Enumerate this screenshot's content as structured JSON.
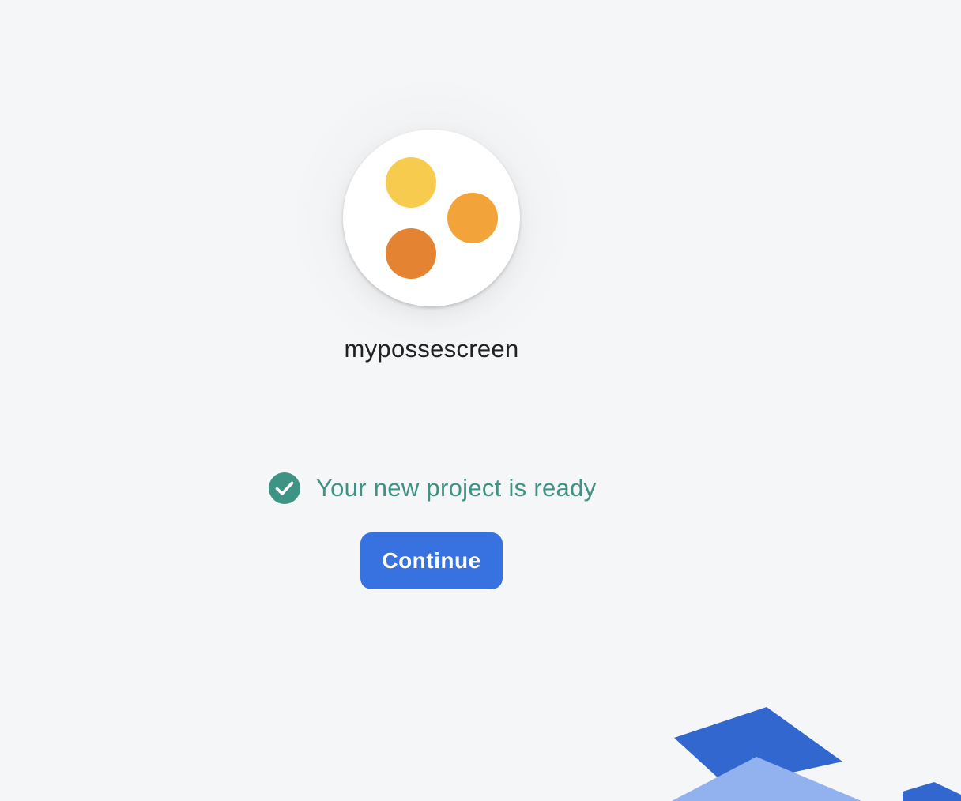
{
  "project": {
    "name": "mypossescreen",
    "logo_dots": [
      {
        "name": "yellow",
        "color": "#F7CC4E"
      },
      {
        "name": "light-orange",
        "color": "#F2A43A"
      },
      {
        "name": "dark-orange",
        "color": "#E48332"
      }
    ]
  },
  "status": {
    "icon": "check-circle-icon",
    "text": "Your new project is ready",
    "color": "#3D9384"
  },
  "actions": {
    "continue_label": "Continue",
    "continue_color": "#3871E0"
  },
  "decor": {
    "colors": {
      "dark_blue": "#3367D0",
      "light_blue": "#92B1EF"
    }
  }
}
